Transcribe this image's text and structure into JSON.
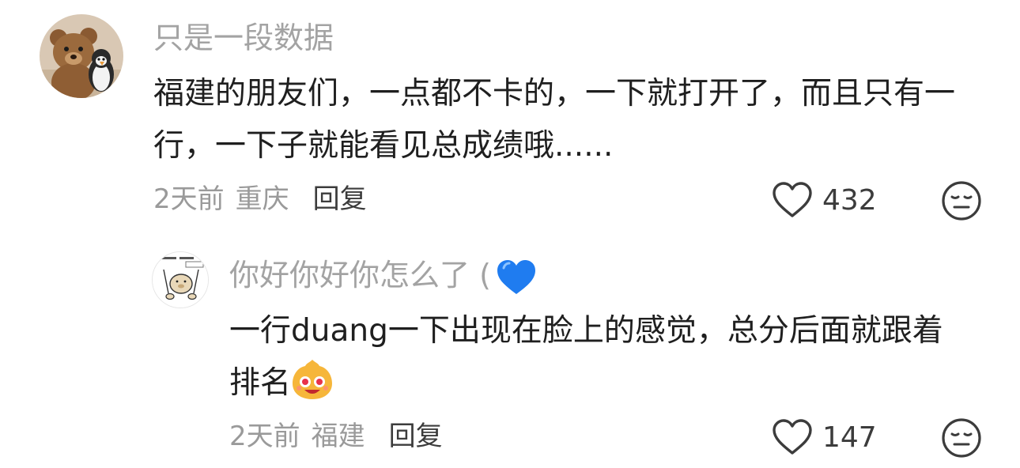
{
  "comments": [
    {
      "username": "只是一段数据",
      "content": "福建的朋友们，一点都不卡的，一下就打开了，而且只有一行，一下子就能看见总成绩哦......",
      "time": "2天前",
      "location": "重庆",
      "reply_label": "回复",
      "likes": "432",
      "avatar_icon": "teddy-bear-avatar"
    },
    {
      "username": "你好你好你怎么了 (",
      "username_emoji": "blue-heart-icon",
      "content": "一行duang一下出现在脸上的感觉，总分后面就跟着排名",
      "content_emoji": "excited-face-emoji",
      "time": "2天前",
      "location": "福建",
      "reply_label": "回复",
      "likes": "147",
      "avatar_icon": "capybara-sketch-avatar"
    }
  ],
  "colors": {
    "username": "#a3a3a3",
    "meta": "#9a9a9a",
    "reply": "#3c3c3c",
    "content": "#1f1f1f",
    "heart_emoji": "#1f7cf0"
  }
}
